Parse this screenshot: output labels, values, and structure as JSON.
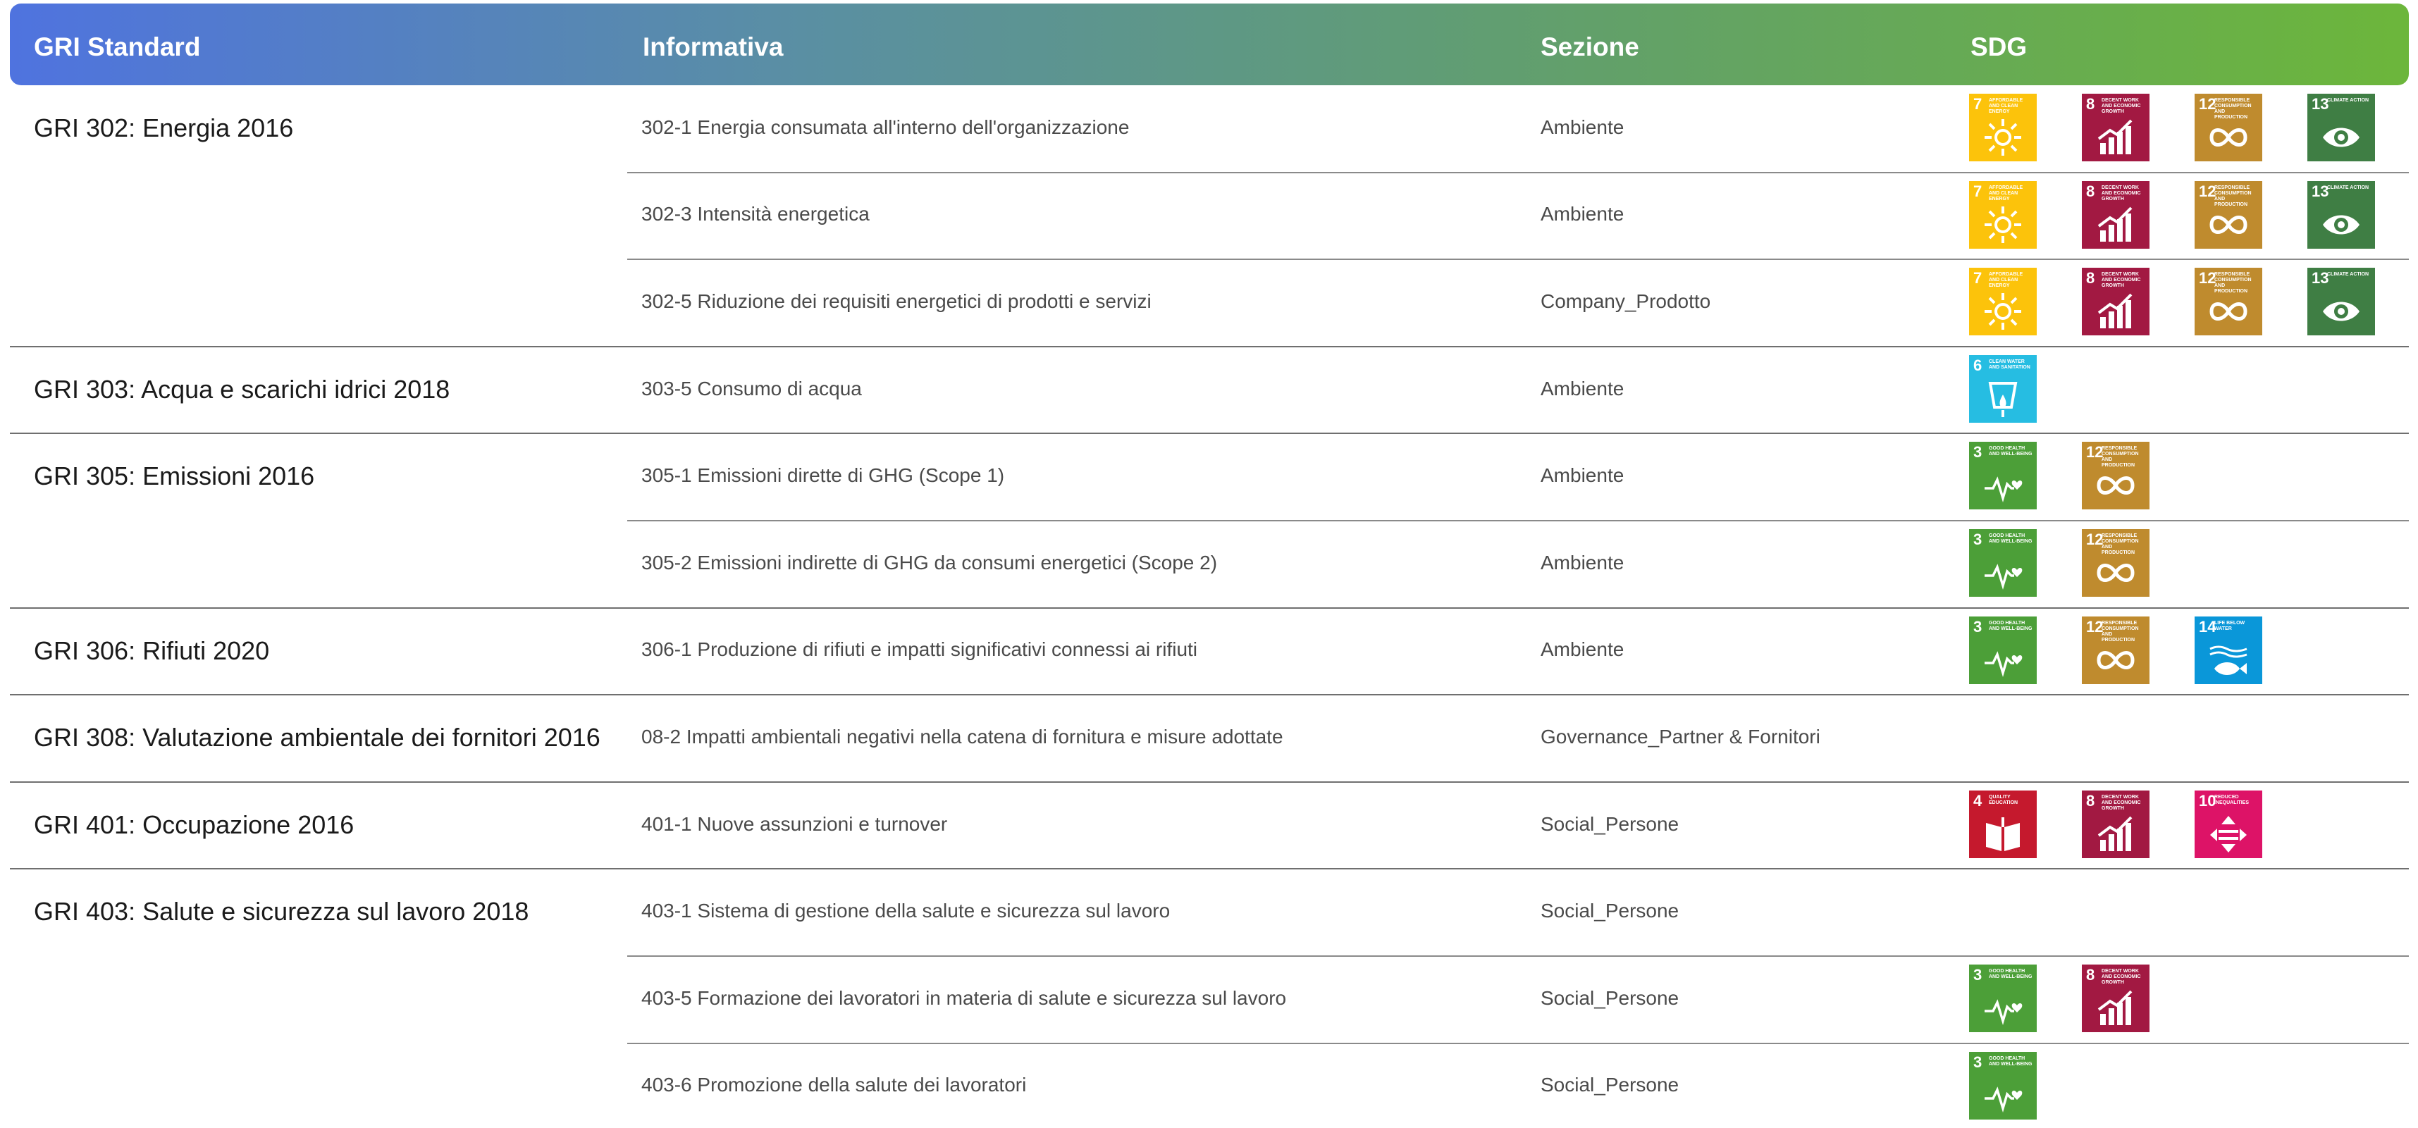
{
  "header": {
    "col_standard": "GRI Standard",
    "col_disclosure": "Informativa",
    "col_section": "Sezione",
    "col_sdg": "SDG"
  },
  "sdg_defs": {
    "3": {
      "num": "3",
      "caption": "Good health and well-being",
      "color": "#4c9f38",
      "icon": "heartbeat-icon"
    },
    "4": {
      "num": "4",
      "caption": "Quality education",
      "color": "#c5192d",
      "icon": "book-icon"
    },
    "6": {
      "num": "6",
      "caption": "Clean water and sanitation",
      "color": "#26bde2",
      "icon": "water-drop-icon"
    },
    "7": {
      "num": "7",
      "caption": "Affordable and clean energy",
      "color": "#fcc30b",
      "icon": "sun-icon"
    },
    "8": {
      "num": "8",
      "caption": "Decent work and economic growth",
      "color": "#a21942",
      "icon": "growth-chart-icon"
    },
    "10": {
      "num": "10",
      "caption": "Reduced inequalities",
      "color": "#dd1367",
      "icon": "equality-icon"
    },
    "12": {
      "num": "12",
      "caption": "Responsible consumption and production",
      "color": "#bf8b2e",
      "icon": "infinity-icon"
    },
    "13": {
      "num": "13",
      "caption": "Climate action",
      "color": "#3f7e44",
      "icon": "eye-globe-icon"
    },
    "14": {
      "num": "14",
      "caption": "Life below water",
      "color": "#0a97d9",
      "icon": "fish-icon"
    }
  },
  "groups": [
    {
      "standard": "GRI 302: Energia 2016",
      "rows": [
        {
          "disclosure": "302-1 Energia consumata all'interno dell'organizzazione",
          "section": "Ambiente",
          "sdgs": [
            "7",
            "8",
            "12",
            "13"
          ]
        },
        {
          "disclosure": "302-3 Intensità energetica",
          "section": "Ambiente",
          "sdgs": [
            "7",
            "8",
            "12",
            "13"
          ]
        },
        {
          "disclosure": "302-5 Riduzione dei requisiti energetici di prodotti e servizi",
          "section": "Company_Prodotto",
          "sdgs": [
            "7",
            "8",
            "12",
            "13"
          ]
        }
      ]
    },
    {
      "standard": "GRI 303: Acqua e scarichi idrici 2018",
      "rows": [
        {
          "disclosure": "303-5 Consumo di acqua",
          "section": "Ambiente",
          "sdgs": [
            "6"
          ]
        }
      ]
    },
    {
      "standard": "GRI 305: Emissioni 2016",
      "rows": [
        {
          "disclosure": "305-1 Emissioni dirette di GHG (Scope 1)",
          "section": "Ambiente",
          "sdgs": [
            "3",
            "12"
          ]
        },
        {
          "disclosure": "305-2 Emissioni indirette di GHG da consumi energetici (Scope 2)",
          "section": "Ambiente",
          "sdgs": [
            "3",
            "12"
          ]
        }
      ]
    },
    {
      "standard": "GRI 306: Rifiuti 2020",
      "rows": [
        {
          "disclosure": "306-1 Produzione di rifiuti e impatti significativi connessi ai rifiuti",
          "section": "Ambiente",
          "sdgs": [
            "3",
            "12",
            "14"
          ]
        }
      ]
    },
    {
      "standard": "GRI 308: Valutazione ambientale dei fornitori 2016",
      "rows": [
        {
          "disclosure": "08-2 Impatti ambientali negativi nella catena di fornitura e misure adottate",
          "section": "Governance_Partner & Fornitori",
          "sdgs": []
        }
      ]
    },
    {
      "standard": "GRI 401: Occupazione 2016",
      "rows": [
        {
          "disclosure": "401-1 Nuove assunzioni e turnover",
          "section": "Social_Persone",
          "sdgs": [
            "4",
            "8",
            "10"
          ]
        }
      ]
    },
    {
      "standard": "GRI 403: Salute e sicurezza sul lavoro 2018",
      "rows": [
        {
          "disclosure": "403-1 Sistema di gestione della salute e sicurezza sul lavoro",
          "section": "Social_Persone",
          "sdgs": []
        },
        {
          "disclosure": "403-5 Formazione dei lavoratori in materia di salute e sicurezza sul lavoro",
          "section": "Social_Persone",
          "sdgs": [
            "3",
            "8"
          ]
        },
        {
          "disclosure": "403-6 Promozione della salute dei lavoratori",
          "section": "Social_Persone",
          "sdgs": [
            "3"
          ]
        }
      ]
    }
  ]
}
